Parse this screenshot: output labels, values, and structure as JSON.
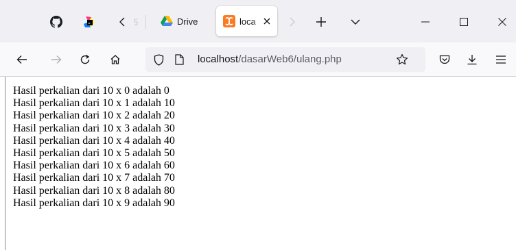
{
  "tabs": [
    {
      "label": "Drive",
      "icon": "google-drive-icon",
      "active": false
    },
    {
      "label": "loca",
      "icon": "xampp-icon",
      "active": true
    }
  ],
  "url": {
    "host": "localhost",
    "path": "/dasarWeb6/ulang.php"
  },
  "page": {
    "lines": [
      "Hasil perkalian dari 10 x 0 adalah 0",
      "Hasil perkalian dari 10 x 1 adalah 10",
      "Hasil perkalian dari 10 x 2 adalah 20",
      "Hasil perkalian dari 10 x 3 adalah 30",
      "Hasil perkalian dari 10 x 4 adalah 40",
      "Hasil perkalian dari 10 x 5 adalah 50",
      "Hasil perkalian dari 10 x 6 adalah 60",
      "Hasil perkalian dari 10 x 7 adalah 70",
      "Hasil perkalian dari 10 x 8 adalah 80",
      "Hasil perkalian dari 10 x 9 adalah 90"
    ]
  },
  "colors": {
    "tabbar": "#f0f0f4",
    "toolbar": "#f9f9fb",
    "xampp": "#fb7a24"
  }
}
